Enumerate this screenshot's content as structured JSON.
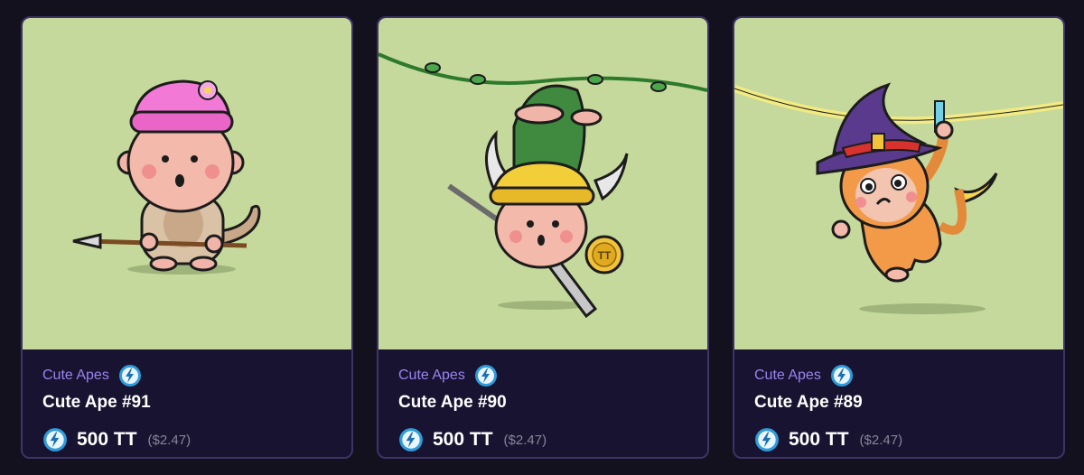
{
  "cards": [
    {
      "collection": "Cute Apes",
      "title": "Cute Ape #91",
      "price": "500 TT",
      "usd": "($2.47)",
      "art_background": "#c6d99c"
    },
    {
      "collection": "Cute Apes",
      "title": "Cute Ape #90",
      "price": "500 TT",
      "usd": "($2.47)",
      "art_background": "#c6d99c"
    },
    {
      "collection": "Cute Apes",
      "title": "Cute Ape #89",
      "price": "500 TT",
      "usd": "($2.47)",
      "art_background": "#c6d99c"
    }
  ],
  "icons": {
    "collection_badge": "lightning-badge-icon",
    "currency": "tt-token-icon"
  },
  "colors": {
    "page_background": "#14111f",
    "card_background": "#171330",
    "card_border": "#3d3468",
    "collection_text": "#9b83f0",
    "title_text": "#ffffff",
    "usd_text": "#8a8599"
  }
}
